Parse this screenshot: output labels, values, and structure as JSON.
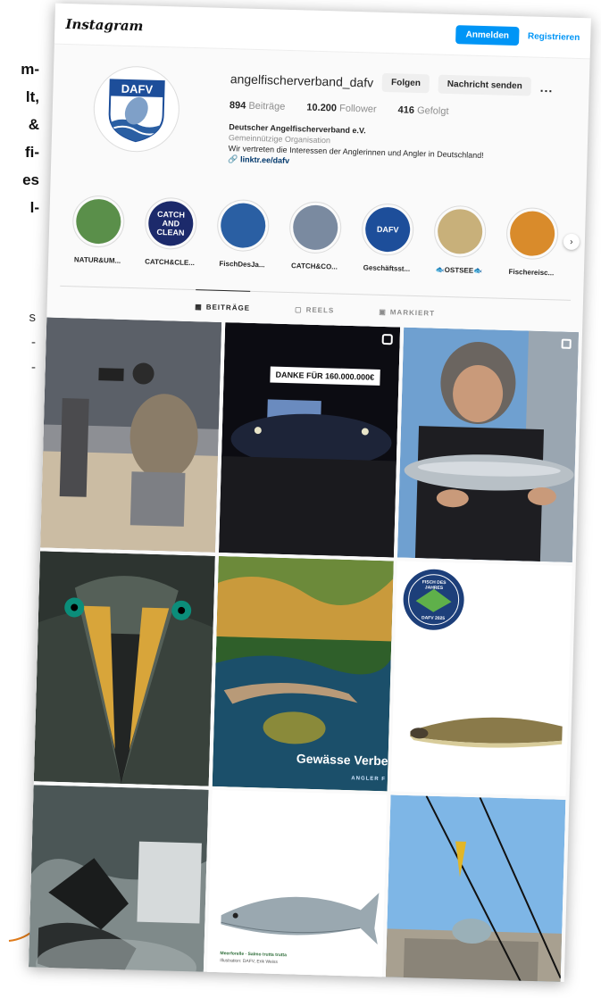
{
  "article": {
    "bold_lines": [
      "m-",
      "lt,",
      "&",
      "fi-",
      "es",
      "l-"
    ],
    "plain_lines": [
      "s",
      "-",
      "-"
    ]
  },
  "app": {
    "logo": "Instagram"
  },
  "auth": {
    "login_label": "Anmelden",
    "register_label": "Registrieren"
  },
  "profile": {
    "username": "angelfischerverband_dafv",
    "follow_label": "Folgen",
    "message_label": "Nachricht senden",
    "more_label": "...",
    "avatar_text": "DAFV",
    "posts_count": "894",
    "posts_label": "Beiträge",
    "followers_count": "10.200",
    "followers_label": "Follower",
    "following_count": "416",
    "following_label": "Gefolgt",
    "full_name": "Deutscher Angelfischerverband e.V.",
    "category": "Gemeinnützige Organisation",
    "bio": "Wir vertreten die Interessen der Anglerinnen und Angler in Deutschland!",
    "link": "linktr.ee/dafv"
  },
  "highlights": [
    {
      "label": "NATUR&UM...",
      "color": "#5a8f4a",
      "icon": "nature-icon"
    },
    {
      "label": "CATCH&CLE...",
      "color": "#1c2a6b",
      "icon": "catch-clean-icon",
      "text": "CATCH AND CLEAN"
    },
    {
      "label": "FischDesJa...",
      "color": "#2a5fa3",
      "icon": "fish-of-year-icon"
    },
    {
      "label": "CATCH&CO...",
      "color": "#7a8aa0",
      "icon": "person-photo-icon"
    },
    {
      "label": "Geschäftsst...",
      "color": "#1d4e9a",
      "icon": "dafv-logo-icon",
      "text": "DAFV"
    },
    {
      "label": "🐟OSTSEE🐟",
      "color": "#c8b07a",
      "icon": "ostsee-photo-icon"
    },
    {
      "label": "Fischereisc...",
      "color": "#d98b2b",
      "icon": "sunset-photo-icon"
    }
  ],
  "tabs": [
    {
      "label": "BEITRÄGE",
      "icon": "grid-icon",
      "active": true
    },
    {
      "label": "REELS",
      "icon": "reels-icon",
      "active": false
    },
    {
      "label": "MARKIERT",
      "icon": "tagged-icon",
      "active": false
    }
  ],
  "posts": [
    {
      "name": "post-photographer",
      "kind": "photo"
    },
    {
      "name": "post-concert",
      "kind": "reel",
      "caption": "DANKE FÜR 160.000.000€"
    },
    {
      "name": "post-angler-trout",
      "kind": "carousel"
    },
    {
      "name": "post-cormorant-closeup",
      "kind": "photo"
    },
    {
      "name": "post-river-aerial",
      "kind": "carousel",
      "caption": "Gewässe Verbe",
      "sub": "ANGLER F"
    },
    {
      "name": "post-fish-of-year",
      "kind": "photo",
      "badge_top": "FISCH DES JAHRES",
      "badge_bottom": "DAFV 2025"
    },
    {
      "name": "post-cormorants-water",
      "kind": "photo"
    },
    {
      "name": "post-salmon",
      "kind": "photo",
      "caption": "Meerforelle · Salmo trutta trutta",
      "sub": "Illustration: DAFV, Erik Weiss"
    },
    {
      "name": "post-reichstag-rods",
      "kind": "photo"
    }
  ],
  "colors": {
    "accent": "#0095f6",
    "link": "#00376b",
    "muted": "#8e8e8e"
  }
}
